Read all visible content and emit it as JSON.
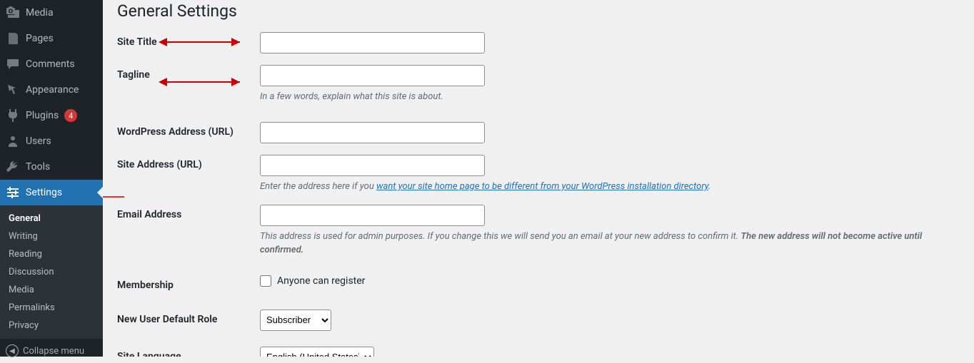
{
  "sidebar": {
    "items": [
      {
        "label": "Media",
        "iconName": "media-icon"
      },
      {
        "label": "Pages",
        "iconName": "pages-icon"
      },
      {
        "label": "Comments",
        "iconName": "comments-icon"
      },
      {
        "label": "Appearance",
        "iconName": "appearance-icon"
      },
      {
        "label": "Plugins",
        "iconName": "plugins-icon",
        "badge": "4"
      },
      {
        "label": "Users",
        "iconName": "users-icon"
      },
      {
        "label": "Tools",
        "iconName": "tools-icon"
      },
      {
        "label": "Settings",
        "iconName": "settings-icon",
        "active": true
      }
    ],
    "submenu": [
      {
        "label": "General",
        "current": true
      },
      {
        "label": "Writing"
      },
      {
        "label": "Reading"
      },
      {
        "label": "Discussion"
      },
      {
        "label": "Media"
      },
      {
        "label": "Permalinks"
      },
      {
        "label": "Privacy"
      }
    ],
    "collapse_label": "Collapse menu"
  },
  "page": {
    "title": "General Settings",
    "fields": {
      "site_title": {
        "label": "Site Title",
        "value": ""
      },
      "tagline": {
        "label": "Tagline",
        "value": "",
        "desc": "In a few words, explain what this site is about."
      },
      "wp_address": {
        "label": "WordPress Address (URL)",
        "value": ""
      },
      "site_address": {
        "label": "Site Address (URL)",
        "value": "",
        "desc_prefix": "Enter the address here if you ",
        "desc_link": "want your site home page to be different from your WordPress installation directory",
        "desc_suffix": "."
      },
      "email": {
        "label": "Email Address",
        "value": "",
        "desc_plain": "This address is used for admin purposes. If you change this we will send you an email at your new address to confirm it. ",
        "desc_strong": "The new address will not become active until confirmed."
      },
      "membership": {
        "label": "Membership",
        "checkbox_label": "Anyone can register",
        "checked": false
      },
      "default_role": {
        "label": "New User Default Role",
        "value": "Subscriber"
      },
      "site_language": {
        "label": "Site Language",
        "value": "English (United States)"
      }
    }
  }
}
